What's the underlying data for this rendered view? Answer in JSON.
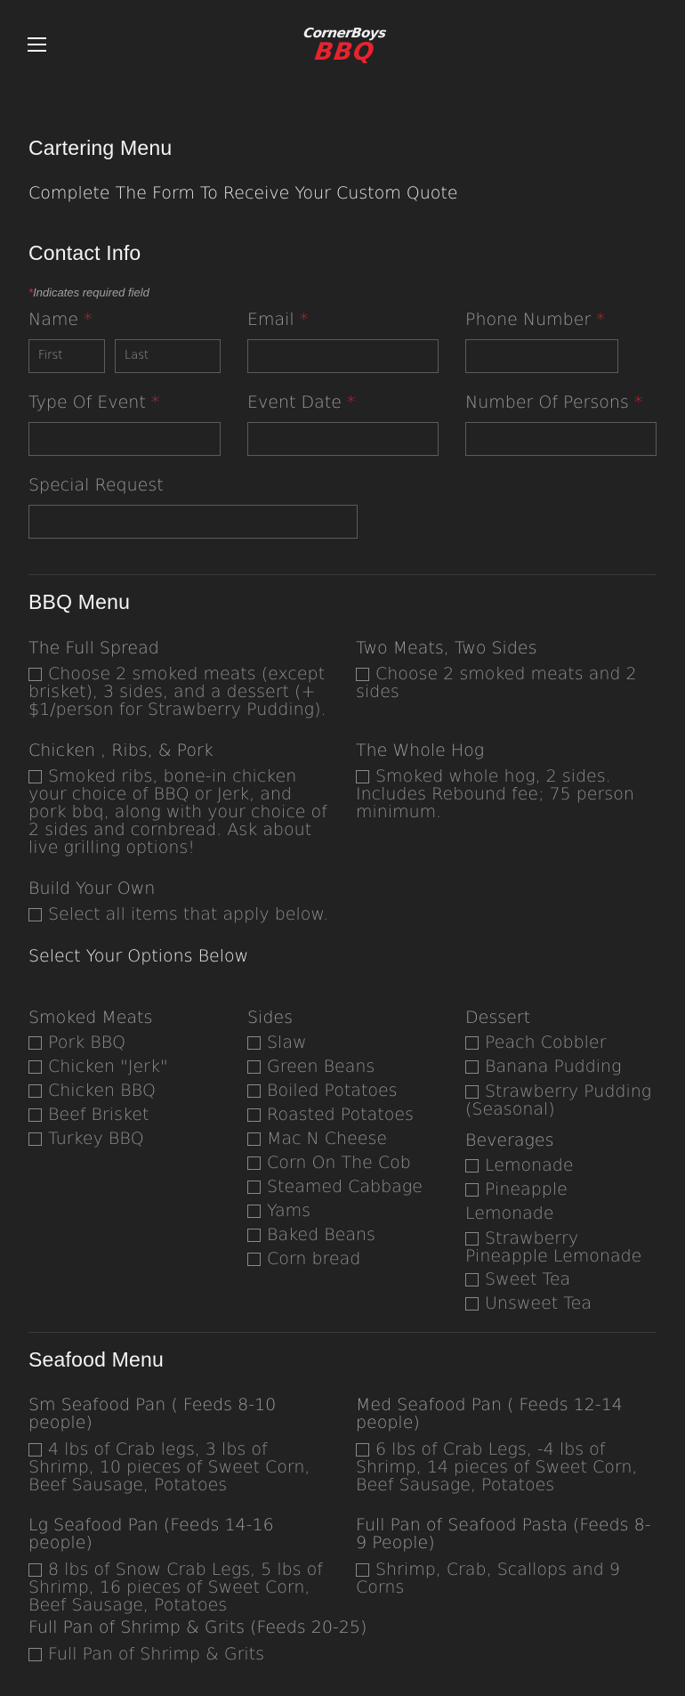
{
  "header": {
    "logo_top": "CornerBoys",
    "logo_bottom": "BBQ"
  },
  "page": {
    "title": "Cartering Menu",
    "lead": "Complete The Form To Receive Your Custom Quote"
  },
  "contact": {
    "title": "Contact Info",
    "required_note": "Indicates required field",
    "star": "*",
    "fields": {
      "name": "Name",
      "first_placeholder": "First",
      "last_placeholder": "Last",
      "email": "Email",
      "phone": "Phone Number",
      "event_type": "Type Of Event",
      "event_date": "Event Date",
      "persons": "Number Of Persons",
      "special": "Special Request"
    }
  },
  "bbq": {
    "title": "BBQ Menu",
    "options": [
      {
        "title": "The Full Spread",
        "text": "Choose 2 smoked meats (except brisket), 3 sides, and a dessert (+ $1/person for Strawberry Pudding)."
      },
      {
        "title": "Two Meats, Two Sides",
        "text": "Choose 2 smoked meats and 2 sides"
      },
      {
        "title": "Chicken , Ribs, & Pork",
        "text": "Smoked ribs, bone-in chicken your choice of BBQ or Jerk, and pork bbq, along with your choice of 2 sides and cornbread. Ask about live grilling options!"
      },
      {
        "title": "The Whole Hog",
        "text": "Smoked whole hog, 2 sides. Includes Rebound fee; 75 person minimum."
      },
      {
        "title": "Build Your Own",
        "text": "Select all items that apply below."
      }
    ],
    "select_below": "Select Your Options Below",
    "meats": {
      "title": "Smoked Meats",
      "items": [
        "Pork BBQ",
        "Chicken \"Jerk\"",
        "Chicken BBQ",
        "Beef Brisket",
        "Turkey BBQ"
      ]
    },
    "sides": {
      "title": "Sides",
      "items": [
        "Slaw",
        "Green Beans",
        "Boiled Potatoes",
        "Roasted Potatoes",
        "Mac N Cheese",
        "Corn On The Cob",
        "Steamed Cabbage",
        "Yams",
        "Baked Beans",
        "Corn bread"
      ]
    },
    "dessert": {
      "title": "Dessert",
      "items": [
        "Peach Cobbler",
        "Banana Pudding",
        "Strawberry Pudding (Seasonal)"
      ]
    },
    "beverages": {
      "title": "Beverages",
      "items": [
        "Lemonade",
        "Pineapple Lemonade",
        "Strawberry Pineapple Lemonade",
        "Sweet Tea",
        "Unsweet Tea"
      ]
    }
  },
  "seafood": {
    "title": "Seafood Menu",
    "options": [
      {
        "title": "Sm Seafood Pan ( Feeds 8-10 people)",
        "text": "4 lbs of Crab legs, 3 lbs of Shrimp, 10 pieces of Sweet Corn, Beef Sausage, Potatoes"
      },
      {
        "title": "Med Seafood Pan ( Feeds 12-14 people)",
        "text": "6 lbs of Crab Legs, -4 lbs of Shrimp, 14 pieces of Sweet Corn, Beef Sausage, Potatoes"
      },
      {
        "title": "Lg Seafood Pan (Feeds 14-16 people)",
        "text": "8 lbs of Snow Crab Legs, 5 lbs of Shrimp, 16 pieces of Sweet Corn, Beef Sausage, Potatoes"
      },
      {
        "title": "Full Pan of Seafood Pasta (Feeds 8-9 People)",
        "text": "Shrimp, Crab, Scallops and 9 Corns"
      },
      {
        "title": "Full Pan of Shrimp & Grits (Feeds 20-25)",
        "text": "Full Pan of Shrimp & Grits"
      }
    ]
  },
  "colors": {
    "background": "#222223",
    "accent": "#e8232e",
    "text": "#9b9b9b"
  }
}
